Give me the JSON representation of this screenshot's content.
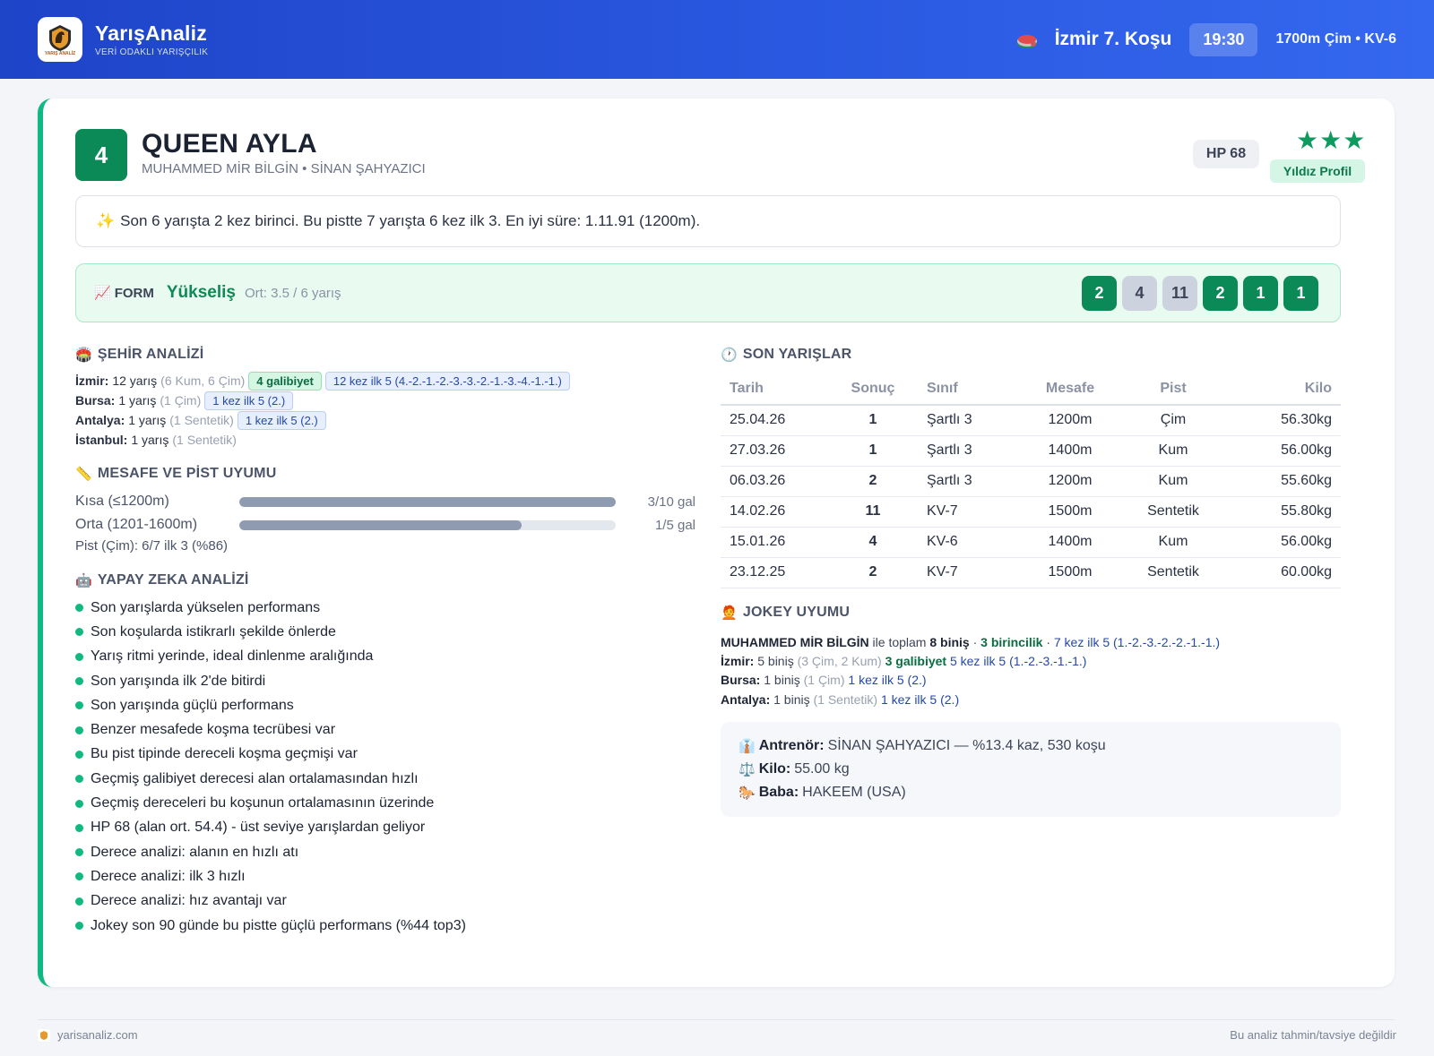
{
  "header": {
    "brand_name": "YarışAnaliz",
    "brand_sub": "VERİ ODAKLI YARIŞÇILIK",
    "logo_text": "YARIŞ ANALİZ",
    "race_title": "İzmir 7. Koşu",
    "race_time": "19:30",
    "race_info": "1700m Çim • KV-6"
  },
  "horse": {
    "number": "4",
    "name": "QUEEN AYLA",
    "people": "MUHAMMED MİR BİLGİN • SİNAN ŞAHYAZICI",
    "hp": "HP 68",
    "stars": "★★★",
    "star_label": "Yıldız Profil"
  },
  "summary": {
    "icon": "✨",
    "text": "Son 6 yarışta 2 kez birinci. Bu pistte 7 yarışta 6 kez ilk 3. En iyi süre: 1.11.91 (1200m)."
  },
  "form": {
    "icon": "📈",
    "label": "FORM",
    "status": "Yükseliş",
    "avg": "Ort: 3.5 / 6 yarış",
    "results": [
      "2",
      "4",
      "11",
      "2",
      "1",
      "1"
    ],
    "accent": "#0b8a57"
  },
  "city": {
    "title": "ŞEHİR ANALİZİ",
    "icon": "🏟️",
    "rows": [
      {
        "city": "İzmir:",
        "count": "12 yarış",
        "detail": "(6 Kum, 6 Çim)",
        "wins": "4 galibiyet",
        "top5": "12 kez ilk 5 (4.-2.-1.-2.-3.-3.-2.-1.-3.-4.-1.-1.)"
      },
      {
        "city": "Bursa:",
        "count": "1 yarış",
        "detail": "(1 Çim)",
        "wins": "",
        "top5": "1 kez ilk 5 (2.)"
      },
      {
        "city": "Antalya:",
        "count": "1 yarış",
        "detail": "(1 Sentetik)",
        "wins": "",
        "top5": "1 kez ilk 5 (2.)"
      },
      {
        "city": "İstanbul:",
        "count": "1 yarış",
        "detail": "(1 Sentetik)",
        "wins": "",
        "top5": ""
      }
    ]
  },
  "distance": {
    "title": "MESAFE VE PİST UYUMU",
    "icon": "📏",
    "rows": [
      {
        "label": "Kısa (≤1200m)",
        "value": "3/10 gal",
        "fill": 1.0
      },
      {
        "label": "Orta (1201-1600m)",
        "value": "1/5 gal",
        "fill": 0.75
      }
    ],
    "pist": "Pist (Çim): 6/7 ilk 3 (%86)"
  },
  "ai": {
    "title": "YAPAY ZEKA ANALİZİ",
    "icon": "🤖",
    "items": [
      "Son yarışlarda yükselen performans",
      "Son koşularda istikrarlı şekilde önlerde",
      "Yarış ritmi yerinde, ideal dinlenme aralığında",
      "Son yarışında ilk 2'de bitirdi",
      "Son yarışında güçlü performans",
      "Benzer mesafede koşma tecrübesi var",
      "Bu pist tipinde dereceli koşma geçmişi var",
      "Geçmiş galibiyet derecesi alan ortalamasından hızlı",
      "Geçmiş dereceleri bu koşunun ortalamasının üzerinde",
      "HP 68 (alan ort. 54.4) - üst seviye yarışlardan geliyor",
      "Derece analizi: alanın en hızlı atı",
      "Derece analizi: ilk 3 hızlı",
      "Derece analizi: hız avantajı var",
      "Jokey son 90 günde bu pistte güçlü performans (%44 top3)"
    ]
  },
  "races": {
    "title": "SON YARIŞLAR",
    "icon": "🕐",
    "columns": [
      "Tarih",
      "Sonuç",
      "Sınıf",
      "Mesafe",
      "Pist",
      "Kilo"
    ],
    "rows": [
      [
        "25.04.26",
        "1",
        "Şartlı 3",
        "1200m",
        "Çim",
        "56.30kg"
      ],
      [
        "27.03.26",
        "1",
        "Şartlı 3",
        "1400m",
        "Kum",
        "56.00kg"
      ],
      [
        "06.03.26",
        "2",
        "Şartlı 3",
        "1200m",
        "Kum",
        "55.60kg"
      ],
      [
        "14.02.26",
        "11",
        "KV-7",
        "1500m",
        "Sentetik",
        "55.80kg"
      ],
      [
        "15.01.26",
        "4",
        "KV-6",
        "1400m",
        "Kum",
        "56.00kg"
      ],
      [
        "23.12.25",
        "2",
        "KV-7",
        "1500m",
        "Sentetik",
        "60.00kg"
      ]
    ]
  },
  "jockey": {
    "title": "JOKEY UYUMU",
    "icon": "🧑‍🦰",
    "name": "MUHAMMED MİR BİLGİN",
    "total_pre": "ile toplam",
    "total": "8 biniş",
    "sep": "·",
    "firsts": "3 birincilik",
    "top5": "7 kez ilk 5 (1.-2.-3.-2.-2.-1.-1.)",
    "cities": [
      {
        "city": "İzmir:",
        "count": "5 biniş",
        "detail": "(3 Çim, 2 Kum)",
        "wins": "3 galibiyet",
        "top5": "5 kez ilk 5 (1.-2.-3.-1.-1.)"
      },
      {
        "city": "Bursa:",
        "count": "1 biniş",
        "detail": "(1 Çim)",
        "wins": "",
        "top5": "1 kez ilk 5 (2.)"
      },
      {
        "city": "Antalya:",
        "count": "1 biniş",
        "detail": "(1 Sentetik)",
        "wins": "",
        "top5": "1 kez ilk 5 (2.)"
      }
    ]
  },
  "info": {
    "trainer_label": "Antrenör:",
    "trainer": "SİNAN ŞAHYAZICI — %13.4 kaz, 530 koşu",
    "kilo_label": "Kilo:",
    "kilo": "55.00 kg",
    "sire_label": "Baba:",
    "sire": "HAKEEM (USA)"
  },
  "footer": {
    "site": "yarisanaliz.com",
    "disclaimer": "Bu analiz tahmin/tavsiye değildir"
  }
}
